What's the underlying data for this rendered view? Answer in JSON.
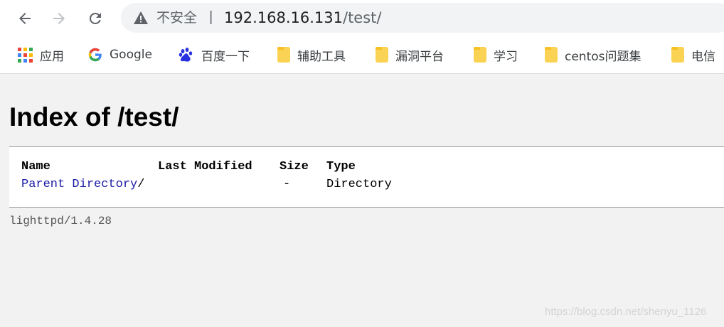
{
  "browser": {
    "security_label": "不安全",
    "separator": "|",
    "url_host": "192.168.16.131",
    "url_path": "/test/",
    "icons": {
      "back": "arrow-left-icon",
      "forward": "arrow-right-icon",
      "reload": "reload-icon",
      "security": "warning-triangle-icon"
    }
  },
  "bookmarks": [
    {
      "label": "应用",
      "icon": "apps-grid-icon"
    },
    {
      "label": "Google",
      "icon": "google-g-icon"
    },
    {
      "label": "百度一下",
      "icon": "baidu-paw-icon"
    },
    {
      "label": "辅助工具",
      "icon": "folder-icon"
    },
    {
      "label": "漏洞平台",
      "icon": "folder-icon"
    },
    {
      "label": "学习",
      "icon": "folder-icon"
    },
    {
      "label": "centos问题集",
      "icon": "folder-icon"
    },
    {
      "label": "电信",
      "icon": "folder-icon"
    }
  ],
  "page": {
    "title": "Index of /test/",
    "columns": [
      "Name",
      "Last Modified",
      "Size",
      "Type"
    ],
    "rows": [
      {
        "name": "Parent Directory",
        "suffix": "/",
        "modified": "",
        "size": "-",
        "type": "Directory"
      }
    ],
    "footer": "lighttpd/1.4.28"
  },
  "watermark": "https://blog.csdn.net/shenyu_1126",
  "colors": {
    "link": "#1a1aa6",
    "folder": "#fbd354",
    "page_bg": "#f2f2f2"
  }
}
